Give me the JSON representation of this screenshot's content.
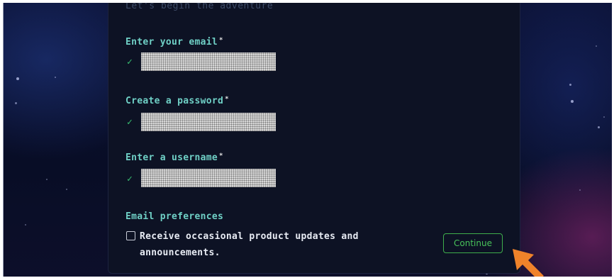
{
  "form": {
    "subtitle": "Let's begin the adventure",
    "fields": [
      {
        "label": "Enter your email",
        "required": "*"
      },
      {
        "label": "Create a password",
        "required": "*"
      },
      {
        "label": "Enter a username",
        "required": "*"
      }
    ],
    "preferences_label": "Email preferences",
    "checkbox_text": "Receive occasional product updates and announcements.",
    "continue_label": "Continue"
  },
  "icons": {
    "valid": "checkmark-icon",
    "pointer": "arrow-pointer-icon"
  },
  "colors": {
    "accent": "#6fd0c6",
    "success": "#38c172",
    "button": "#48c35a",
    "pointer": "#f0832a"
  }
}
